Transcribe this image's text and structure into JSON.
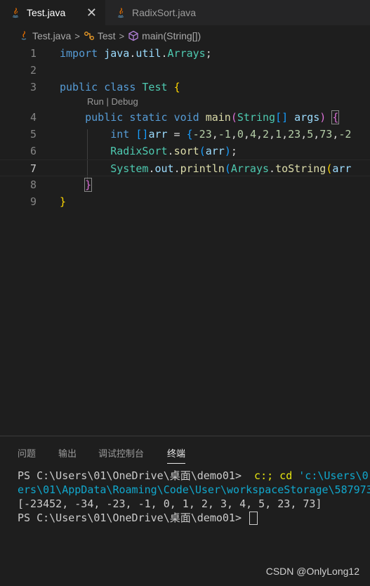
{
  "tabs": [
    {
      "label": "Test.java",
      "active": true,
      "close": "✕"
    },
    {
      "label": "RadixSort.java",
      "active": false
    }
  ],
  "breadcrumb": {
    "file": "Test.java",
    "class": "Test",
    "method": "main(String[])"
  },
  "codelens": "Run | Debug",
  "editor": {
    "line_numbers": [
      "1",
      "2",
      "3",
      "4",
      "5",
      "6",
      "7",
      "8",
      "9"
    ],
    "current_line": 7,
    "lines": [
      {
        "segments": [
          {
            "t": "import",
            "c": "kw"
          },
          {
            "t": " ",
            "c": "plain"
          },
          {
            "t": "java",
            "c": "var"
          },
          {
            "t": ".",
            "c": "plain"
          },
          {
            "t": "util",
            "c": "var"
          },
          {
            "t": ".",
            "c": "plain"
          },
          {
            "t": "Arrays",
            "c": "cls"
          },
          {
            "t": ";",
            "c": "plain"
          }
        ]
      },
      {
        "segments": []
      },
      {
        "segments": [
          {
            "t": "public",
            "c": "kw"
          },
          {
            "t": " ",
            "c": "plain"
          },
          {
            "t": "class",
            "c": "kw"
          },
          {
            "t": " ",
            "c": "plain"
          },
          {
            "t": "Test",
            "c": "cls"
          },
          {
            "t": " ",
            "c": "plain"
          },
          {
            "t": "{",
            "c": "br1"
          }
        ]
      },
      {
        "segments": [
          {
            "t": "    ",
            "c": "plain"
          },
          {
            "t": "public",
            "c": "kw"
          },
          {
            "t": " ",
            "c": "plain"
          },
          {
            "t": "static",
            "c": "kw"
          },
          {
            "t": " ",
            "c": "plain"
          },
          {
            "t": "void",
            "c": "kw"
          },
          {
            "t": " ",
            "c": "plain"
          },
          {
            "t": "main",
            "c": "fn"
          },
          {
            "t": "(",
            "c": "br2"
          },
          {
            "t": "String",
            "c": "cls"
          },
          {
            "t": "[]",
            "c": "br3"
          },
          {
            "t": " ",
            "c": "plain"
          },
          {
            "t": "args",
            "c": "var"
          },
          {
            "t": ")",
            "c": "br2"
          },
          {
            "t": " ",
            "c": "plain"
          },
          {
            "t": "{",
            "c": "br2 bracket-match"
          }
        ]
      },
      {
        "segments": [
          {
            "t": "        ",
            "c": "plain"
          },
          {
            "t": "int",
            "c": "kw"
          },
          {
            "t": " ",
            "c": "plain"
          },
          {
            "t": "[]",
            "c": "br3"
          },
          {
            "t": "arr",
            "c": "var"
          },
          {
            "t": " = ",
            "c": "plain"
          },
          {
            "t": "{",
            "c": "br3"
          },
          {
            "t": "-23",
            "c": "num"
          },
          {
            "t": ",",
            "c": "plain"
          },
          {
            "t": "-1",
            "c": "num"
          },
          {
            "t": ",",
            "c": "plain"
          },
          {
            "t": "0",
            "c": "num"
          },
          {
            "t": ",",
            "c": "plain"
          },
          {
            "t": "4",
            "c": "num"
          },
          {
            "t": ",",
            "c": "plain"
          },
          {
            "t": "2",
            "c": "num"
          },
          {
            "t": ",",
            "c": "plain"
          },
          {
            "t": "1",
            "c": "num"
          },
          {
            "t": ",",
            "c": "plain"
          },
          {
            "t": "23",
            "c": "num"
          },
          {
            "t": ",",
            "c": "plain"
          },
          {
            "t": "5",
            "c": "num"
          },
          {
            "t": ",",
            "c": "plain"
          },
          {
            "t": "73",
            "c": "num"
          },
          {
            "t": ",",
            "c": "plain"
          },
          {
            "t": "-2",
            "c": "num"
          }
        ]
      },
      {
        "segments": [
          {
            "t": "        ",
            "c": "plain"
          },
          {
            "t": "RadixSort",
            "c": "cls"
          },
          {
            "t": ".",
            "c": "plain"
          },
          {
            "t": "sort",
            "c": "fn"
          },
          {
            "t": "(",
            "c": "br3"
          },
          {
            "t": "arr",
            "c": "var"
          },
          {
            "t": ")",
            "c": "br3"
          },
          {
            "t": ";",
            "c": "plain"
          }
        ]
      },
      {
        "segments": [
          {
            "t": "        ",
            "c": "plain"
          },
          {
            "t": "System",
            "c": "cls"
          },
          {
            "t": ".",
            "c": "plain"
          },
          {
            "t": "out",
            "c": "var"
          },
          {
            "t": ".",
            "c": "plain"
          },
          {
            "t": "println",
            "c": "fn"
          },
          {
            "t": "(",
            "c": "br3"
          },
          {
            "t": "Arrays",
            "c": "cls"
          },
          {
            "t": ".",
            "c": "plain"
          },
          {
            "t": "toString",
            "c": "fn"
          },
          {
            "t": "(",
            "c": "br1"
          },
          {
            "t": "arr",
            "c": "var"
          }
        ]
      },
      {
        "segments": [
          {
            "t": "    ",
            "c": "plain"
          },
          {
            "t": "}",
            "c": "br2 bracket-match"
          }
        ]
      },
      {
        "segments": [
          {
            "t": "}",
            "c": "br1"
          }
        ]
      }
    ]
  },
  "panel": {
    "tabs": [
      {
        "label": "问题",
        "active": false
      },
      {
        "label": "输出",
        "active": false
      },
      {
        "label": "调试控制台",
        "active": false
      },
      {
        "label": "终端",
        "active": true
      }
    ],
    "terminal": {
      "line1_prompt": "PS C:\\Users\\01\\OneDrive\\桌面\\demo01> ",
      "line1_cmd": " c:; cd ",
      "line1_path": "'c:\\Users\\0",
      "line2": "ers\\01\\AppData\\Roaming\\Code\\User\\workspaceStorage\\587973",
      "line3": "[-23452, -34, -23, -1, 0, 1, 2, 3, 4, 5, 23, 73]",
      "line4_prompt": "PS C:\\Users\\01\\OneDrive\\桌面\\demo01> "
    }
  },
  "watermark": "CSDN @OnlyLong12"
}
